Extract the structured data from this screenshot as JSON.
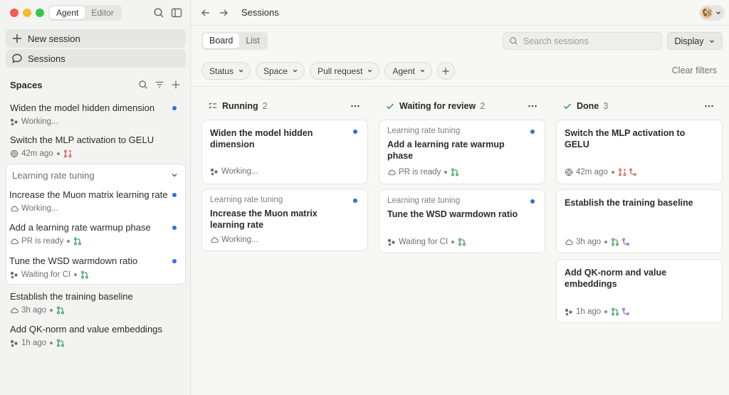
{
  "sidebar": {
    "mode_tabs": [
      "Agent",
      "Editor"
    ],
    "new_session_label": "New session",
    "sessions_label": "Sessions",
    "spaces_title": "Spaces",
    "items": [
      {
        "title": "Widen the model hidden dimension",
        "status": "Working...",
        "unread": true
      },
      {
        "title": "Switch the MLP activation to GELU",
        "status": "42m ago",
        "unread": false
      }
    ],
    "group": {
      "name": "Learning rate tuning",
      "items": [
        {
          "title": "Increase the Muon matrix learning rate",
          "status": "Working...",
          "unread": true
        },
        {
          "title": "Add a learning rate warmup phase",
          "status": "PR is ready",
          "unread": true
        },
        {
          "title": "Tune the WSD warmdown ratio",
          "status": "Waiting for CI",
          "unread": true
        }
      ]
    },
    "after_items": [
      {
        "title": "Establish the training baseline",
        "status": "3h ago"
      },
      {
        "title": "Add QK-norm and value embeddings",
        "status": "1h ago"
      }
    ]
  },
  "header": {
    "breadcrumb": "Sessions",
    "avatar_emoji": "🐿"
  },
  "toolbar": {
    "views": [
      "Board",
      "List"
    ],
    "active_view": "Board",
    "search_placeholder": "Search sessions",
    "display_label": "Display",
    "filters": [
      "Status",
      "Space",
      "Pull request",
      "Agent"
    ],
    "clear_filters": "Clear filters"
  },
  "columns": [
    {
      "name": "Running",
      "count": "2",
      "cards": [
        {
          "space": "",
          "title": "Widen the model hidden dimension",
          "status": "Working..."
        },
        {
          "space": "Learning rate tuning",
          "title": "Increase the Muon matrix learning rate",
          "status": "Working..."
        }
      ]
    },
    {
      "name": "Waiting for review",
      "count": "2",
      "cards": [
        {
          "space": "Learning rate tuning",
          "title": "Add a learning rate warmup phase",
          "status": "PR is ready"
        },
        {
          "space": "Learning rate tuning",
          "title": "Tune the WSD warmdown ratio",
          "status": "Waiting for CI"
        }
      ]
    },
    {
      "name": "Done",
      "count": "3",
      "cards": [
        {
          "space": "",
          "title": "Switch the MLP activation to GELU",
          "status": "42m ago"
        },
        {
          "space": "",
          "title": "Establish the training baseline",
          "status": "3h ago"
        },
        {
          "space": "",
          "title": "Add QK-norm and value embeddings",
          "status": "1h ago"
        }
      ]
    }
  ],
  "colors": {
    "unread_dot": "#2f6fe0",
    "pr_open": "#2e9a57",
    "pr_closed": "#d9534f",
    "merged": "#9b59b6",
    "traffic_red": "#ee5f57",
    "traffic_yellow": "#f5bd2e",
    "traffic_green": "#35c84a"
  }
}
